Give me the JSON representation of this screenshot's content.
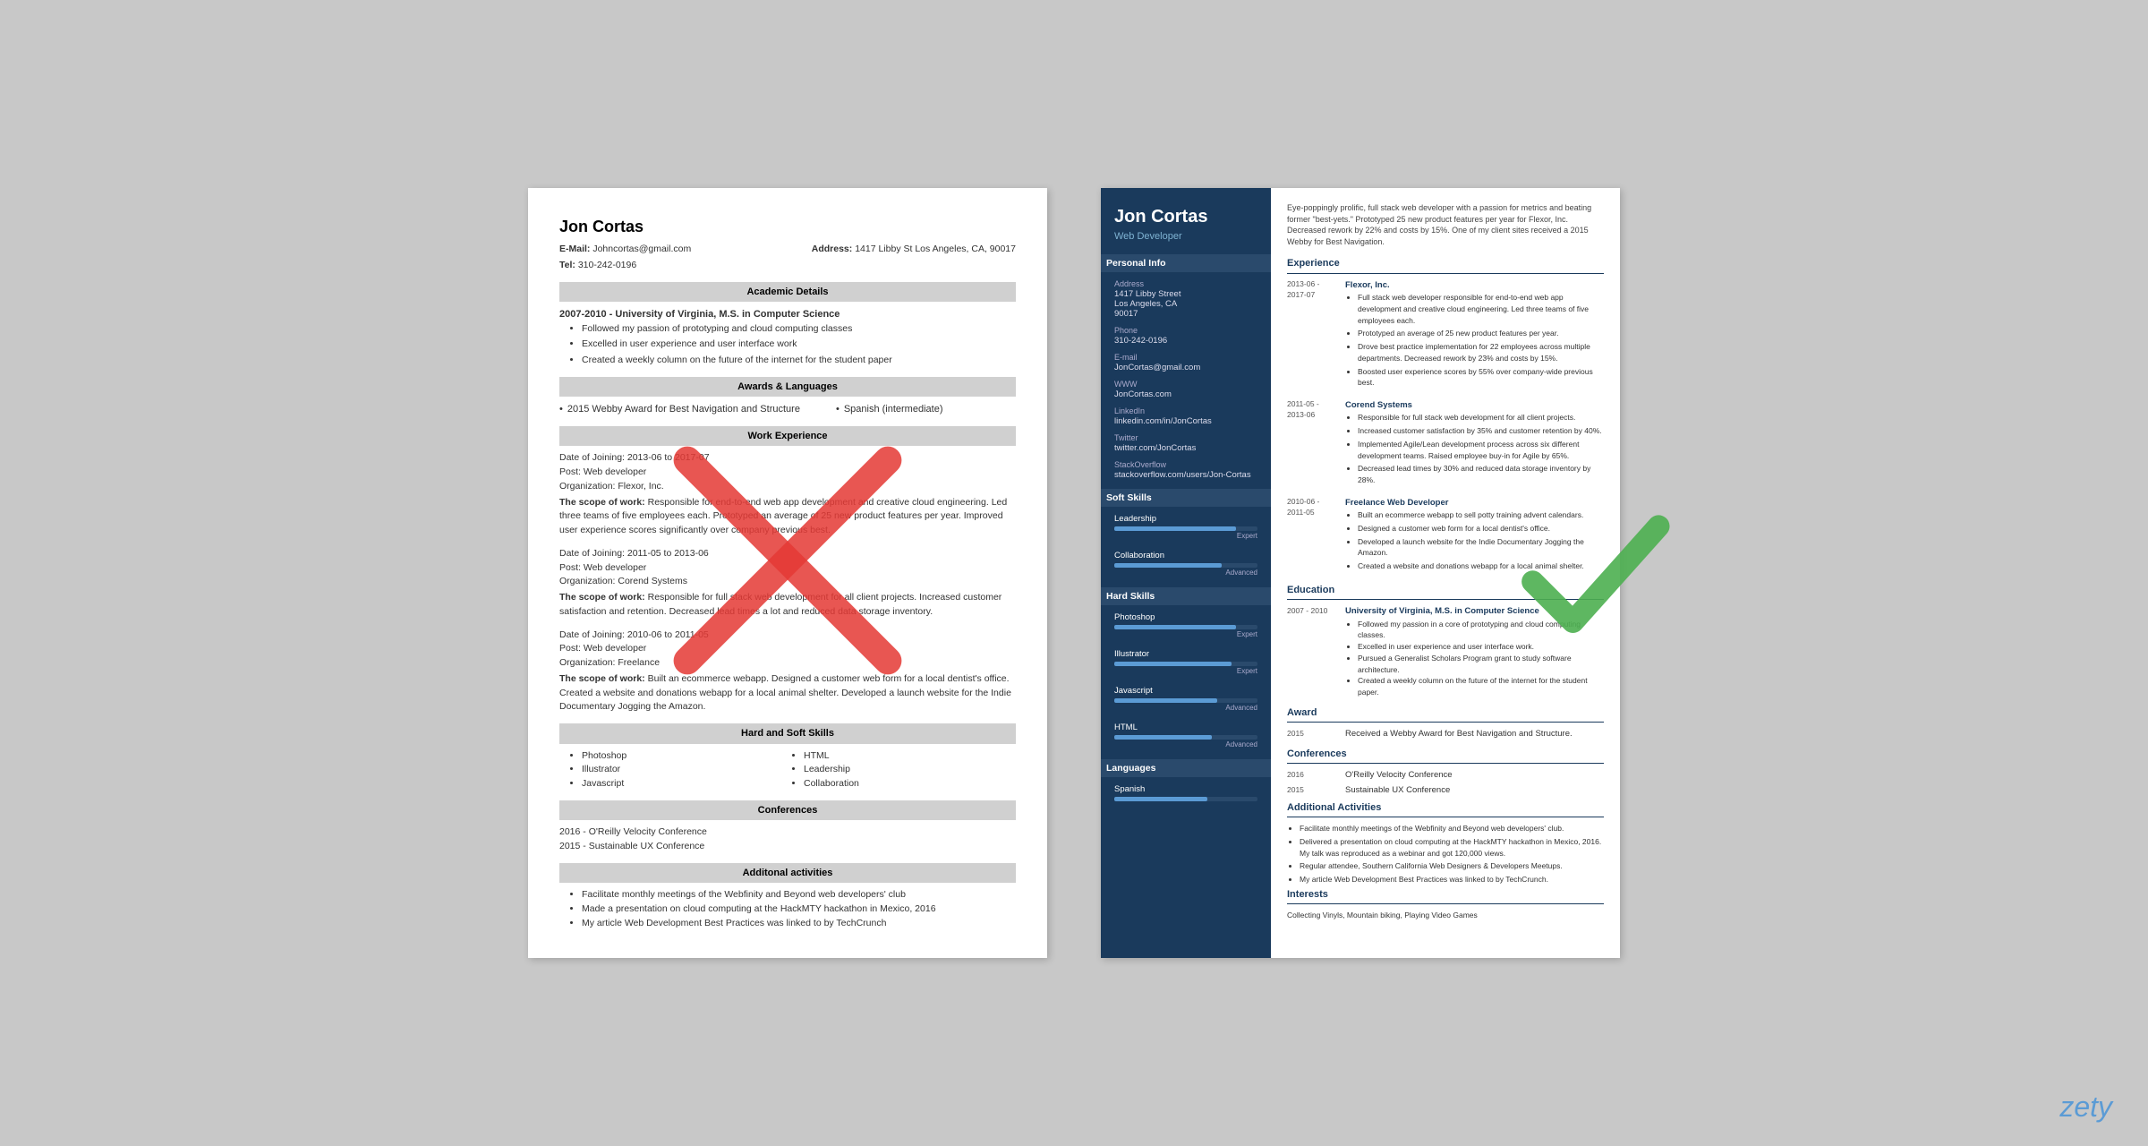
{
  "left_resume": {
    "name": "Jon Cortas",
    "email_label": "E-Mail:",
    "email": "Johncortas@gmail.com",
    "address_label": "Address:",
    "address": "1417 Libby St Los Angeles, CA, 90017",
    "tel_label": "Tel:",
    "tel": "310-242-0196",
    "sections": {
      "academic": {
        "header": "Academic Details",
        "entry": {
          "year_title": "2007-2010 - University of Virginia, M.S. in Computer Science",
          "bullets": [
            "Followed my passion of prototyping and cloud computing classes",
            "Excelled in user experience and user interface work",
            "Created a weekly column on the future of the internet for the student paper"
          ]
        }
      },
      "awards": {
        "header": "Awards & Languages",
        "item1": "2015 Webby Award for Best Navigation and Structure",
        "item2": "Spanish (intermediate)"
      },
      "work": {
        "header": "Work Experience",
        "entries": [
          {
            "date": "Date of Joining: 2013-06 to 2017-07",
            "post": "Post: Web developer",
            "org": "Organization: Flexor, Inc.",
            "scope_label": "The scope of work:",
            "scope_text": "Responsible for end-to-end web app development and creative cloud engineering. Led three teams of five employees each. Prototyped an average of 25 new product features per year. Improved user experience scores significantly over company previous best."
          },
          {
            "date": "Date of Joining: 2011-05 to 2013-06",
            "post": "Post: Web developer",
            "org": "Organization: Corend Systems",
            "scope_label": "The scope of work:",
            "scope_text": "Responsible for full stack web development for all client projects. Increased customer satisfaction and retention. Decreased lead times a lot and reduced data storage inventory."
          },
          {
            "date": "Date of Joining: 2010-06 to 2011-05",
            "post": "Post: Web developer",
            "org": "Organization: Freelance",
            "scope_label": "The scope of work:",
            "scope_text": "Built an ecommerce webapp. Designed a customer web form for a local dentist's office. Created a website and donations webapp for a local animal shelter. Developed a launch website for the Indie Documentary Jogging the Amazon."
          }
        ]
      },
      "skills": {
        "header": "Hard and Soft Skills",
        "items": [
          "Photoshop",
          "Illustrator",
          "Javascript",
          "HTML",
          "Leadership",
          "Collaboration"
        ]
      },
      "conferences": {
        "header": "Conferences",
        "items": [
          "2016 - O'Reilly Velocity Conference",
          "2015 - Sustainable UX Conference"
        ]
      },
      "activities": {
        "header": "Additonal activities",
        "items": [
          "Facilitate monthly meetings of the Webfinity and Beyond web developers' club",
          "Made a presentation on cloud computing at the HackMTY hackathon in Mexico, 2016",
          "My article Web Development Best Practices was linked to by TechCrunch"
        ]
      }
    }
  },
  "right_resume": {
    "sidebar": {
      "name": "Jon Cortas",
      "title": "Web Developer",
      "personal_info_header": "Personal Info",
      "address_label": "Address",
      "address_lines": [
        "1417 Libby Street",
        "Los Angeles, CA",
        "90017"
      ],
      "phone_label": "Phone",
      "phone": "310-242-0196",
      "email_label": "E-mail",
      "email": "JonCortas@gmail.com",
      "www_label": "WWW",
      "www": "JonCortas.com",
      "linkedin_label": "LinkedIn",
      "linkedin": "linkedin.com/in/JonCortas",
      "twitter_label": "Twitter",
      "twitter": "twitter.com/JonCortas",
      "stackoverflow_label": "StackOverflow",
      "stackoverflow": "stackoverflow.com/users/Jon-Cortas",
      "soft_skills_header": "Soft Skills",
      "soft_skills": [
        {
          "name": "Leadership",
          "level": "Expert",
          "pct": 85
        },
        {
          "name": "Collaboration",
          "level": "Advanced",
          "pct": 75
        }
      ],
      "hard_skills_header": "Hard Skills",
      "hard_skills": [
        {
          "name": "Photoshop",
          "level": "Expert",
          "pct": 85
        },
        {
          "name": "Illustrator",
          "level": "Expert",
          "pct": 82
        },
        {
          "name": "Javascript",
          "level": "Advanced",
          "pct": 72
        },
        {
          "name": "HTML",
          "level": "Advanced",
          "pct": 68
        }
      ],
      "languages_header": "Languages",
      "languages": [
        {
          "name": "Spanish",
          "level": "",
          "pct": 65
        }
      ]
    },
    "main": {
      "intro": "Eye-poppingly prolific, full stack web developer with a passion for metrics and beating former \"best-yets.\" Prototyped 25 new product features per year for Flexor, Inc. Decreased rework by 22% and costs by 15%. One of my client sites received a 2015 Webby for Best Navigation.",
      "experience_header": "Experience",
      "experiences": [
        {
          "dates": "2013-06 - 2017-07",
          "company": "Flexor, Inc.",
          "bullets": [
            "Full stack web developer responsible for end-to-end web app development and creative cloud engineering. Led three teams of five employees each.",
            "Prototyped an average of 25 new product features per year.",
            "Drove best practice implementation for 22 employees across multiple departments. Decreased rework by 23% and costs by 15%.",
            "Boosted user experience scores by 55% over company-wide previous best."
          ]
        },
        {
          "dates": "2011-05 - 2013-06",
          "company": "Corend Systems",
          "bullets": [
            "Responsible for full stack web development for all client projects.",
            "Increased customer satisfaction by 35% and customer retention by 40%.",
            "Implemented Agile/Lean development process across six different development teams. Raised employee buy-in for Agile by 65%.",
            "Decreased lead times by 30% and reduced data storage inventory by 28%."
          ]
        },
        {
          "dates": "2010-06 - 2011-05",
          "company": "Freelance Web Developer",
          "bullets": [
            "Built an ecommerce webapp to sell potty training advent calendars.",
            "Designed a customer web form for a local dentist's office.",
            "Developed a launch website for the Indie Documentary Jogging the Amazon.",
            "Created a website and donations webapp for a local animal shelter."
          ]
        }
      ],
      "education_header": "Education",
      "educations": [
        {
          "dates": "2007 - 2010",
          "school": "University of Virginia, M.S. in Computer Science",
          "bullets": [
            "Followed my passion in a core of prototyping and cloud computing classes.",
            "Excelled in user experience and user interface work.",
            "Pursued a Generalist Scholars Program grant to study software architecture.",
            "Created a weekly column on the future of the internet for the student paper."
          ]
        }
      ],
      "award_header": "Award",
      "awards": [
        {
          "year": "2015",
          "text": "Received a Webby Award for Best Navigation and Structure."
        }
      ],
      "conferences_header": "Conferences",
      "conferences": [
        {
          "year": "2016",
          "name": "O'Reilly Velocity Conference"
        },
        {
          "year": "2015",
          "name": "Sustainable UX Conference"
        }
      ],
      "activities_header": "Additional Activities",
      "activities": [
        "Facilitate monthly meetings of the Webfinity and Beyond web developers' club.",
        "Delivered a presentation on cloud computing at the HackMTY hackathon in Mexico, 2016. My talk was reproduced as a webinar and got 120,000 views.",
        "Regular attendee, Southern California Web Designers & Developers Meetups.",
        "My article Web Development Best Practices was linked to by TechCrunch."
      ],
      "interests_header": "Interests",
      "interests": "Collecting Vinyls, Mountain biking, Playing Video Games"
    }
  },
  "zety_label": "zety"
}
